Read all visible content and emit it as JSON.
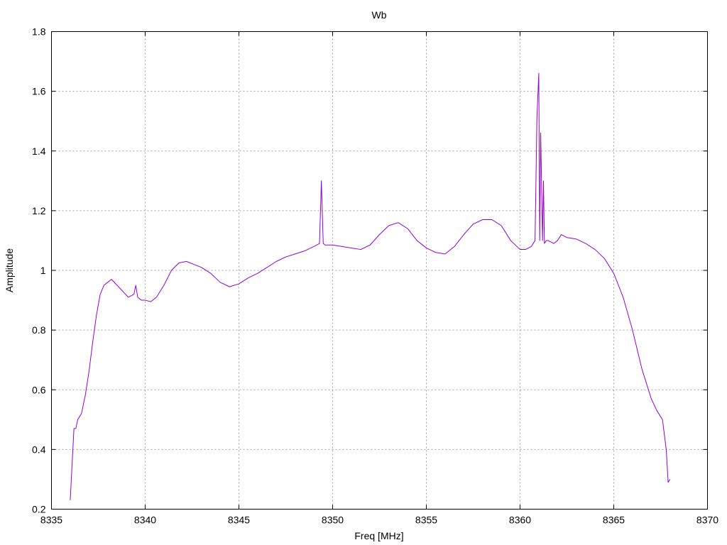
{
  "chart_data": {
    "type": "line",
    "title": "Wb",
    "xlabel": "Freq [MHz]",
    "ylabel": "Amplitude",
    "xlim": [
      8335,
      8370
    ],
    "ylim": [
      0.2,
      1.8
    ],
    "x_ticks": [
      8335,
      8340,
      8345,
      8350,
      8355,
      8360,
      8365,
      8370
    ],
    "y_ticks": [
      0.2,
      0.4,
      0.6,
      0.8,
      1,
      1.2,
      1.4,
      1.6,
      1.8
    ],
    "grid": true,
    "legend": "none",
    "series_color": "#9400d3",
    "series": [
      {
        "x": [
          8336.0,
          8336.1,
          8336.2,
          8336.3,
          8336.4,
          8336.6,
          8336.8,
          8337.0,
          8337.2,
          8337.4,
          8337.6,
          8337.8,
          8338.0,
          8338.2,
          8338.5,
          8338.8,
          8339.1,
          8339.4,
          8339.5,
          8339.6,
          8339.8,
          8340.0,
          8340.3,
          8340.6,
          8341.0,
          8341.4,
          8341.8,
          8342.2,
          8342.6,
          8343.0,
          8343.5,
          8344.0,
          8344.5,
          8345.0,
          8345.5,
          8346.0,
          8346.5,
          8347.0,
          8347.5,
          8348.0,
          8348.5,
          8349.0,
          8349.3,
          8349.4,
          8349.5,
          8349.6,
          8350.0,
          8350.5,
          8351.0,
          8351.5,
          8352.0,
          8352.5,
          8353.0,
          8353.5,
          8354.0,
          8354.5,
          8355.0,
          8355.5,
          8356.0,
          8356.5,
          8357.0,
          8357.5,
          8358.0,
          8358.5,
          8359.0,
          8359.5,
          8360.0,
          8360.3,
          8360.6,
          8360.8,
          8360.9,
          8361.0,
          8361.05,
          8361.1,
          8361.2,
          8361.25,
          8361.3,
          8361.4,
          8361.5,
          8361.8,
          8362.0,
          8362.2,
          8362.5,
          8363.0,
          8363.5,
          8364.0,
          8364.5,
          8365.0,
          8365.5,
          8366.0,
          8366.5,
          8367.0,
          8367.3,
          8367.6,
          8367.8,
          8367.9,
          8368.0
        ],
        "y": [
          0.23,
          0.35,
          0.47,
          0.47,
          0.5,
          0.52,
          0.58,
          0.66,
          0.76,
          0.85,
          0.92,
          0.95,
          0.96,
          0.97,
          0.95,
          0.93,
          0.91,
          0.92,
          0.95,
          0.91,
          0.9,
          0.9,
          0.895,
          0.91,
          0.95,
          1.0,
          1.025,
          1.03,
          1.02,
          1.01,
          0.99,
          0.96,
          0.945,
          0.955,
          0.975,
          0.99,
          1.01,
          1.03,
          1.045,
          1.055,
          1.065,
          1.08,
          1.09,
          1.3,
          1.09,
          1.085,
          1.085,
          1.08,
          1.075,
          1.07,
          1.085,
          1.12,
          1.15,
          1.16,
          1.14,
          1.1,
          1.075,
          1.06,
          1.055,
          1.08,
          1.12,
          1.155,
          1.17,
          1.17,
          1.15,
          1.1,
          1.07,
          1.07,
          1.08,
          1.1,
          1.51,
          1.66,
          1.1,
          1.46,
          1.1,
          1.3,
          1.09,
          1.1,
          1.1,
          1.09,
          1.1,
          1.12,
          1.11,
          1.105,
          1.09,
          1.07,
          1.04,
          0.99,
          0.91,
          0.8,
          0.67,
          0.57,
          0.53,
          0.5,
          0.4,
          0.29,
          0.3
        ]
      }
    ]
  }
}
